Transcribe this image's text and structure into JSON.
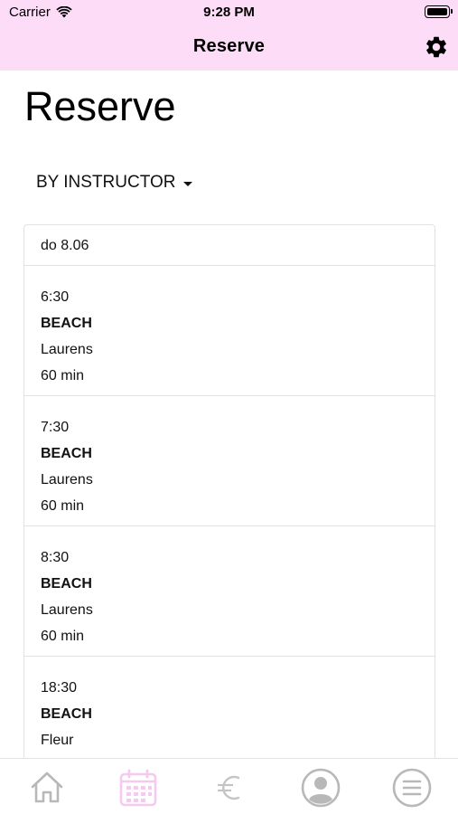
{
  "status_bar": {
    "carrier": "Carrier",
    "time": "9:28 PM"
  },
  "nav": {
    "title": "Reserve",
    "settings_icon": "gear-icon"
  },
  "page": {
    "title": "Reserve"
  },
  "filter": {
    "label": "BY INSTRUCTOR"
  },
  "schedule": {
    "date": "do 8.06",
    "sessions": [
      {
        "time": "6:30",
        "name": "BEACH",
        "instructor": "Laurens",
        "duration": "60 min"
      },
      {
        "time": "7:30",
        "name": "BEACH",
        "instructor": "Laurens",
        "duration": "60 min"
      },
      {
        "time": "8:30",
        "name": "BEACH",
        "instructor": "Laurens",
        "duration": "60 min"
      },
      {
        "time": "18:30",
        "name": "BEACH",
        "instructor": "Fleur",
        "duration": ""
      }
    ]
  },
  "tabbar": {
    "tabs": [
      {
        "icon": "home-icon",
        "active": false
      },
      {
        "icon": "calendar-icon",
        "active": true
      },
      {
        "icon": "euro-icon",
        "active": false
      },
      {
        "icon": "profile-icon",
        "active": false
      },
      {
        "icon": "menu-icon",
        "active": false
      }
    ],
    "active_color": "#f6c9ef",
    "inactive_color": "#b8b8b8"
  },
  "colors": {
    "header_bg": "#fcdcf6"
  }
}
